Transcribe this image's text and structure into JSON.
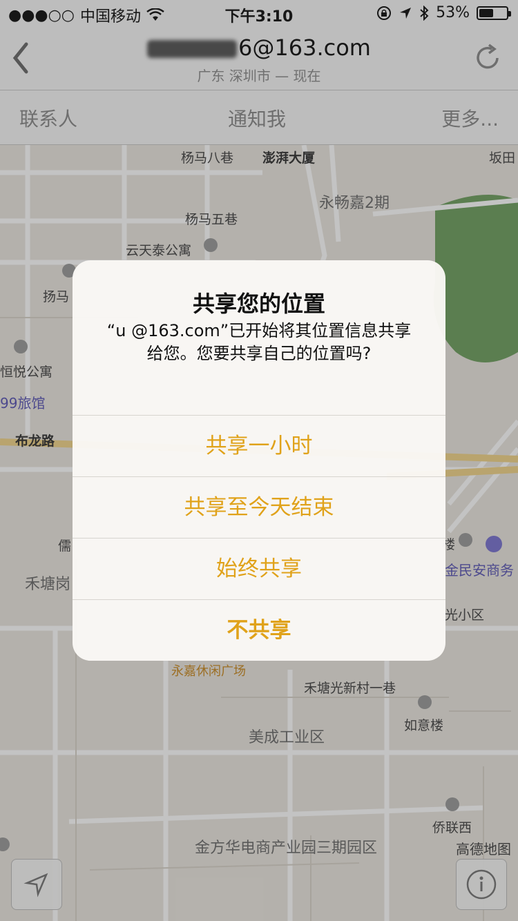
{
  "status_bar": {
    "signal": "●●●○○",
    "carrier": "中国移动",
    "time": "下午3:10",
    "battery_pct": "53%",
    "battery_level": 0.53
  },
  "nav": {
    "title": "6@163.com",
    "subtitle": "广东 深圳市 — 现在"
  },
  "segments": {
    "contacts": "联系人",
    "notify": "通知我",
    "more": "更多..."
  },
  "map": {
    "labels": [
      "杨马八巷",
      "澎湃大厦",
      "坂田",
      "永畅嘉2期",
      "杨马五巷",
      "云天泰公寓",
      "扬马",
      "恒悦公寓",
      "99旅馆",
      "布龙路",
      "儒",
      "禾塘岗",
      "金民安商务",
      "光小区",
      "永嘉休闲广场",
      "禾塘光新村一巷",
      "如意楼",
      "美成工业区",
      "侨联西",
      "金方华电商产业园三期园区",
      "楼"
    ],
    "brand": "高德地图"
  },
  "alert": {
    "title": "共享您的位置",
    "message": "“u            @163.com”已开始将其位置信息共享给您。您要共享自己的位置吗?",
    "buttons": {
      "share_hour": "共享一小时",
      "share_day": "共享至今天结束",
      "share_always": "始终共享",
      "dont_share": "不共享"
    }
  },
  "colors": {
    "accent": "#e0a21a",
    "park": "#6fa060"
  }
}
